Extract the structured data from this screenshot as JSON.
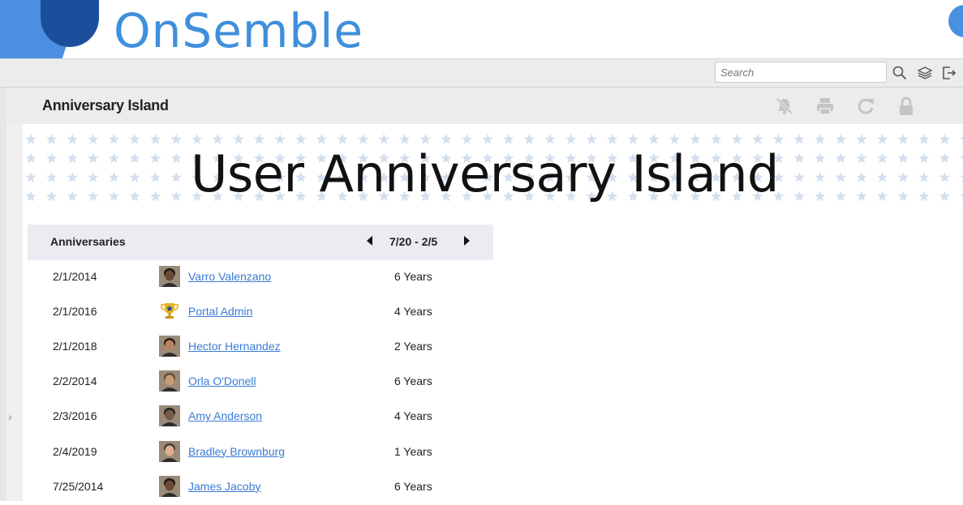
{
  "brand": {
    "name": "OnSemble",
    "color": "#3f8fdc",
    "dark_color": "#1b4f9c"
  },
  "toolbar": {
    "search_placeholder": "Search",
    "icons": [
      "search-icon",
      "layers-icon",
      "logout-icon"
    ]
  },
  "page": {
    "title": "Anniversary Island",
    "actions": [
      "notifications-off-icon",
      "print-icon",
      "refresh-icon",
      "lock-icon"
    ]
  },
  "banner": {
    "title": "User Anniversary Island"
  },
  "anniversaries": {
    "title": "Anniversaries",
    "date_range": "7/20 - 2/5",
    "rows": [
      {
        "date": "2/1/2014",
        "name": "Varro Valenzano",
        "years": "6 Years",
        "avatar": "photo"
      },
      {
        "date": "2/1/2016",
        "name": "Portal Admin",
        "years": "4 Years",
        "avatar": "trophy"
      },
      {
        "date": "2/1/2018",
        "name": "Hector Hernandez",
        "years": "2 Years",
        "avatar": "photo"
      },
      {
        "date": "2/2/2014",
        "name": "Orla O'Donell",
        "years": "6 Years",
        "avatar": "photo"
      },
      {
        "date": "2/3/2016",
        "name": "Amy Anderson",
        "years": "4 Years",
        "avatar": "photo"
      },
      {
        "date": "2/4/2019",
        "name": "Bradley Brownburg",
        "years": "1 Years",
        "avatar": "photo"
      },
      {
        "date": "7/25/2014",
        "name": "James Jacoby",
        "years": "6 Years",
        "avatar": "photo"
      }
    ]
  }
}
